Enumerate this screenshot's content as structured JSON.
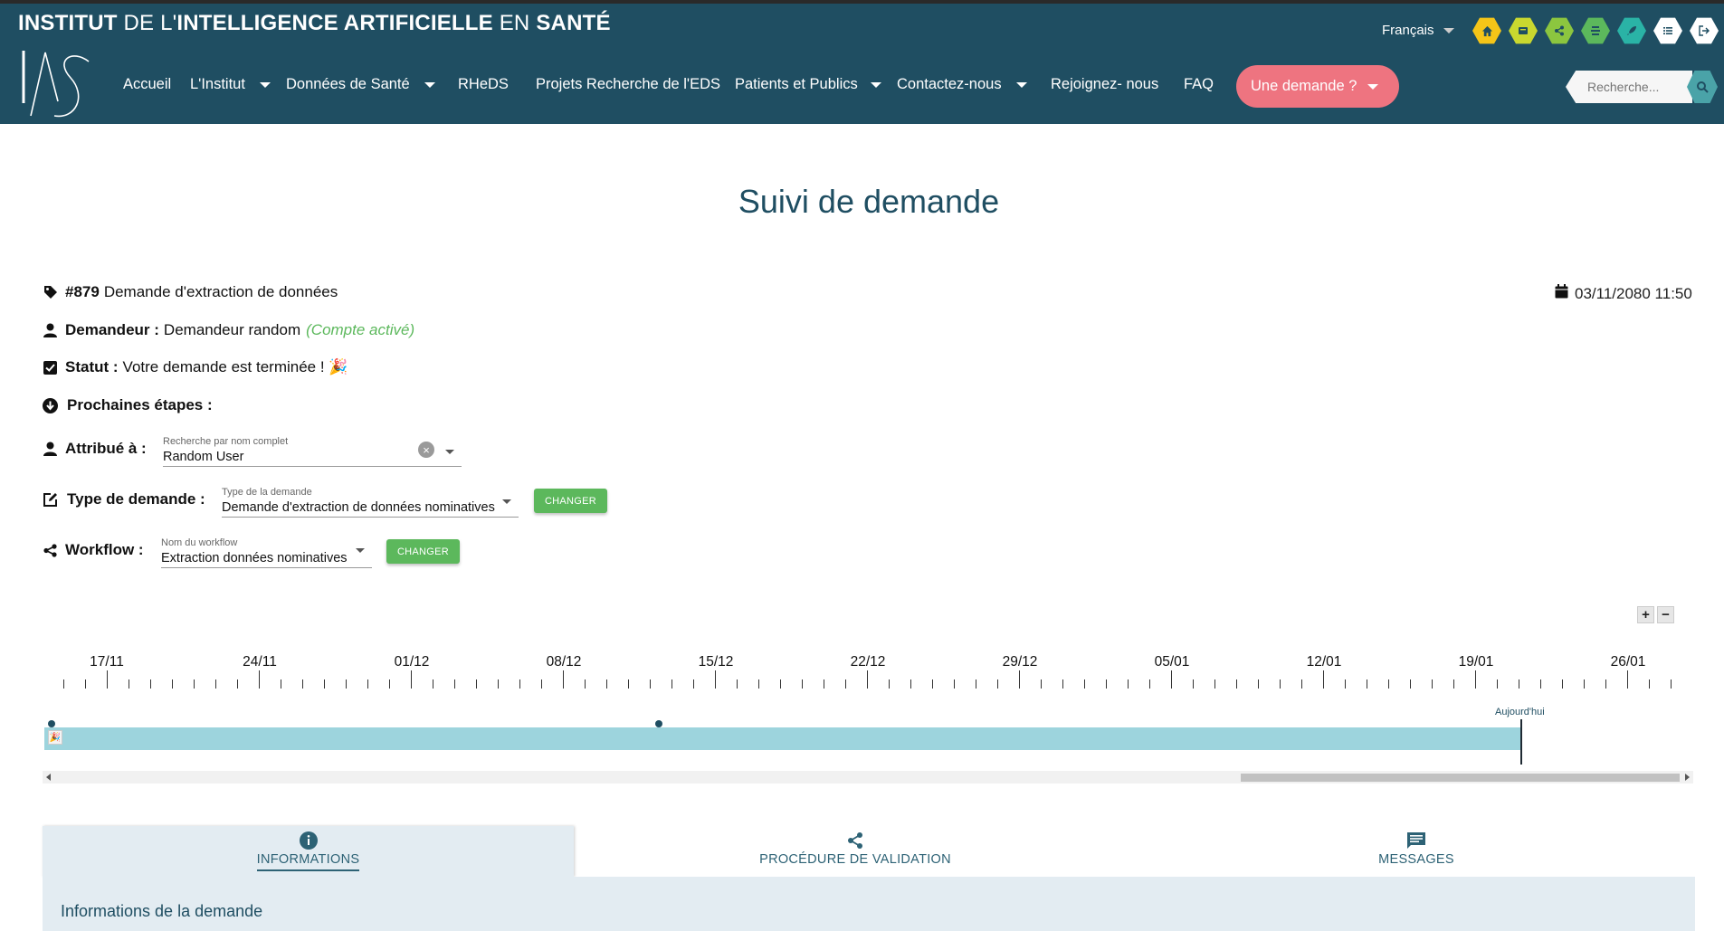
{
  "header": {
    "brand_parts": [
      {
        "text": "INSTITUT",
        "bold": true
      },
      {
        "text": " DE L'",
        "bold": false
      },
      {
        "text": "INTELLIGENCE ARTIFICIELLE",
        "bold": true
      },
      {
        "text": " EN ",
        "bold": false
      },
      {
        "text": "SANTÉ",
        "bold": true
      }
    ],
    "logo_text": "IAS",
    "nav": [
      "Accueil",
      "L'Institut",
      "Données de Santé",
      "RHeDS",
      "Projets Recherche de l'EDS",
      "Patients et Publics",
      "Contactez-nous",
      "Rejoignez- nous",
      "FAQ"
    ],
    "cta_label": "Une demande ?",
    "language": "Français",
    "quick_icons": [
      {
        "name": "home-icon",
        "color": "#f5c518"
      },
      {
        "name": "database-icon",
        "color": "#c9d82f"
      },
      {
        "name": "share-icon",
        "color": "#8cc63f"
      },
      {
        "name": "layers-icon",
        "color": "#5cb85c"
      },
      {
        "name": "rocket-icon",
        "color": "#2ab3a6"
      },
      {
        "name": "list-icon",
        "color": "#ffffff"
      },
      {
        "name": "logout-icon",
        "color": "#ffffff"
      }
    ],
    "search_placeholder": "Recherche..."
  },
  "page_title": "Suivi de demande",
  "request": {
    "number": "#879",
    "title": "Demande d'extraction de données",
    "date": "03/11/2080 11:50",
    "requester_label": "Demandeur :",
    "requester_name": "Demandeur random",
    "requester_status": "(Compte activé)",
    "status_label": "Statut :",
    "status_text": "Votre demande est terminée ! 🎉",
    "next_steps_label": "Prochaines étapes :",
    "assigned_label": "Attribué à :",
    "assigned_field_label": "Recherche par nom complet",
    "assigned_value": "Random User",
    "type_label": "Type de demande :",
    "type_field_label": "Type de la demande",
    "type_value": "Demande d'extraction de données nominatives",
    "workflow_label": "Workflow :",
    "workflow_field_label": "Nom du workflow",
    "workflow_value": "Extraction données nominatives",
    "change_label": "CHANGER"
  },
  "timeline": {
    "dates": [
      "17/11",
      "24/11",
      "01/12",
      "08/12",
      "15/12",
      "22/12",
      "29/12",
      "05/01",
      "12/01",
      "19/01",
      "26/01"
    ],
    "today_label": "Aujourd'hui",
    "zoom_in": "+",
    "zoom_out": "−"
  },
  "tabs": [
    {
      "label": "INFORMATIONS",
      "icon": "info-icon",
      "active": true
    },
    {
      "label": "PROCÉDURE DE VALIDATION",
      "icon": "share-icon",
      "active": false
    },
    {
      "label": "MESSAGES",
      "icon": "message-icon",
      "active": false
    }
  ],
  "panel_title": "Informations de la demande"
}
